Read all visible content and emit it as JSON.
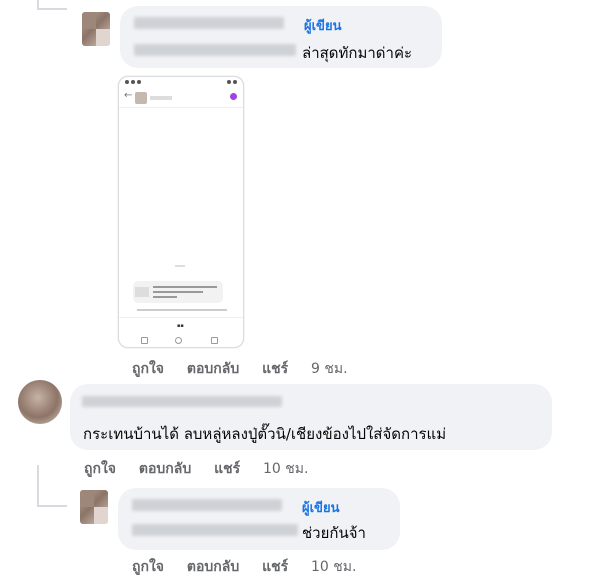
{
  "comments": [
    {
      "author_badge": "ผู้เขียน",
      "text": "ล่าสุดทักมาด่าค่ะ",
      "actions": {
        "like": "ถูกใจ",
        "reply": "ตอบกลับ",
        "share": "แชร์",
        "time": "9 ชม."
      }
    },
    {
      "text": "กระเทนบ้านได้ ลบหลู่หลงปู่ตั๊วนิ/เชียงข้องไปใส่จัดการแม่",
      "actions": {
        "like": "ถูกใจ",
        "reply": "ตอบกลับ",
        "share": "แชร์",
        "time": "10 ชม."
      }
    },
    {
      "author_badge": "ผู้เขียน",
      "text": "ช่วยกันจ้า",
      "actions": {
        "like": "ถูกใจ",
        "reply": "ตอบกลับ",
        "share": "แชร์",
        "time": "10 ชม."
      }
    }
  ],
  "colors": {
    "bubble": "#f0f2f5",
    "badge": "#1b74e4",
    "muted": "#65676b"
  }
}
